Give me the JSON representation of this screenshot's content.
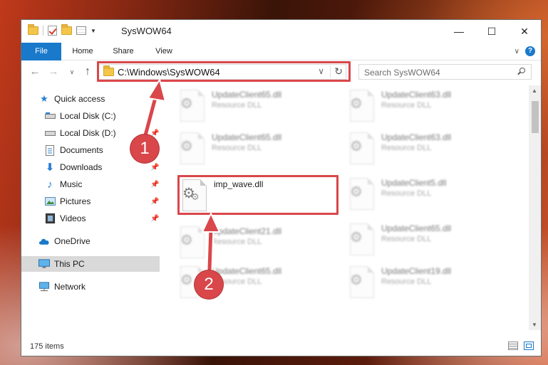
{
  "window": {
    "title": "SysWOW64",
    "minimize_glyph": "—",
    "maximize_glyph": "☐",
    "close_glyph": "✕"
  },
  "ribbon": {
    "tabs": [
      "File",
      "Home",
      "Share",
      "View"
    ],
    "collapse_glyph": "∨",
    "help_glyph": "?"
  },
  "navigation": {
    "back_glyph": "←",
    "forward_glyph": "→",
    "recent_glyph": "∨",
    "up_glyph": "↑"
  },
  "address": {
    "path": "C:\\Windows\\SysWOW64",
    "dropdown_glyph": "∨",
    "refresh_glyph": "↻"
  },
  "search": {
    "placeholder": "Search SysWOW64"
  },
  "sidebar": {
    "items": [
      {
        "label": "Quick access",
        "icon": "star-icon",
        "pinned": false
      },
      {
        "label": "Local Disk (C:)",
        "icon": "drive-icon",
        "pinned": false
      },
      {
        "label": "Local Disk (D:)",
        "icon": "drive-icon",
        "pinned": true
      },
      {
        "label": "Documents",
        "icon": "document-icon",
        "pinned": true
      },
      {
        "label": "Downloads",
        "icon": "download-icon",
        "pinned": true
      },
      {
        "label": "Music",
        "icon": "music-icon",
        "pinned": true
      },
      {
        "label": "Pictures",
        "icon": "pictures-icon",
        "pinned": true
      },
      {
        "label": "Videos",
        "icon": "video-icon",
        "pinned": true
      },
      {
        "label": "OneDrive",
        "icon": "cloud-icon",
        "pinned": false
      },
      {
        "label": "This PC",
        "icon": "computer-icon",
        "pinned": false
      },
      {
        "label": "Network",
        "icon": "network-icon",
        "pinned": false
      }
    ],
    "selected": "This PC"
  },
  "files": {
    "column_left": [
      {
        "name": "UpdateClient65.dll",
        "desc": "Resource DLL",
        "blurred": true
      },
      {
        "name": "UpdateClient65.dll",
        "desc": "Resource DLL",
        "blurred": true
      },
      {
        "name": "imp_wave.dll",
        "desc": "",
        "blurred": false
      },
      {
        "name": "UpdateClient21.dll",
        "desc": "Resource DLL",
        "blurred": true
      },
      {
        "name": "UpdateClient65.dll",
        "desc": "Resource DLL",
        "blurred": true
      }
    ],
    "column_right": [
      {
        "name": "UpdateClient63.dll",
        "desc": "Resource DLL",
        "blurred": true
      },
      {
        "name": "UpdateClient63.dll",
        "desc": "Resource DLL",
        "blurred": true
      },
      {
        "name": "UpdateClient5.dll",
        "desc": "Resource DLL",
        "blurred": true
      },
      {
        "name": "UpdateClient65.dll",
        "desc": "Resource DLL",
        "blurred": true
      },
      {
        "name": "UpdateClient19.dll",
        "desc": "Resource DLL",
        "blurred": true
      }
    ]
  },
  "status": {
    "item_count": "175 items"
  },
  "annotations": {
    "step1": "1",
    "step2": "2",
    "color": "#d9474a"
  }
}
